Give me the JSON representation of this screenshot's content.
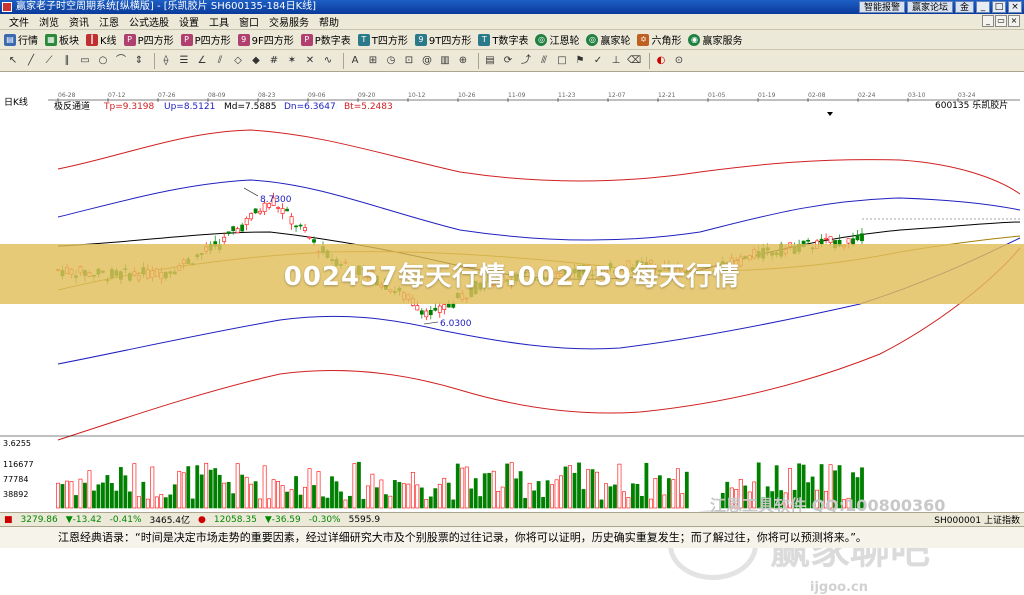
{
  "window": {
    "title": "赢家老子时空周期系统[纵横版] - [乐凯胶片  SH600135-184日K线]",
    "right_buttons": [
      "智能报警",
      "赢家论坛",
      "金"
    ],
    "controls": [
      "_",
      "□",
      "×"
    ]
  },
  "menu": [
    "文件",
    "浏览",
    "资讯",
    "江恩",
    "公式选股",
    "设置",
    "工具",
    "窗口",
    "交易服务",
    "帮助"
  ],
  "toolbar": [
    "行情",
    "板块",
    "K线",
    "P四方形",
    "P四方形",
    "9F四方形",
    "P数字表",
    "T四方形",
    "9T四方形",
    "T数字表",
    "江恩轮",
    "赢家轮",
    "六角形",
    "赢家服务"
  ],
  "chart": {
    "period_label": "日K线",
    "indicator": "极反通道",
    "tp": "Tp=9.3198",
    "up": "Up=8.5121",
    "md": "Md=7.5885",
    "dn": "Dn=6.3647",
    "bt": "Bt=5.2483",
    "stock": "600135 乐凯胶片",
    "dates": [
      "06-28",
      "07-12",
      "07-26",
      "08-09",
      "08-23",
      "09-06",
      "09-20",
      "10-12",
      "10-26",
      "11-09",
      "11-23",
      "12-07",
      "12-21",
      "01-05",
      "01-19",
      "02-08",
      "02-24",
      "03-10",
      "03-24"
    ],
    "high_label": "8.7300",
    "low_label": "6.0300",
    "vol_top": "3.6255",
    "vol_labels": [
      "116677",
      "77784",
      "38892"
    ]
  },
  "chart_data": {
    "type": "bar",
    "title": "",
    "xlabel": "",
    "ylabel": "",
    "categories": [
      "06-28",
      "07-12",
      "07-26",
      "08-09",
      "08-23",
      "09-06",
      "09-20",
      "10-12",
      "10-26",
      "11-09",
      "11-23",
      "12-07",
      "12-21",
      "01-05",
      "01-19",
      "02-08",
      "02-24",
      "03-10",
      "03-24"
    ],
    "series": [
      {
        "values": [
          7.1,
          7.0,
          7.05,
          7.6,
          8.5,
          7.4,
          6.9,
          6.2,
          6.9,
          7.0,
          7.1,
          7.2,
          7.0,
          7.4,
          7.6,
          7.7
        ]
      }
    ],
    "ylim": [
      6.03,
      8.73
    ]
  },
  "watermark": {
    "line1": "江恩工具软件  QQ:100800360",
    "big": "赢家聊吧",
    "small": "ijgoo.cn"
  },
  "banner": "002457每天行情:002759每天行情",
  "status": {
    "sh": "3279.86",
    "sh_chg": "▼-13.42",
    "sh_pct": "-0.41%",
    "sh_amt": "3465.4亿",
    "sz": "12058.35",
    "sz_chg": "▼-36.59",
    "sz_pct": "-0.30%",
    "sz_amt": "5595.9",
    "code": "SH000001 上证指数"
  },
  "tip": "江恩经典语录：“时间是决定市场走势的重要因素，经过详细研究大市及个别股票的过往记录，你将可以证明，历史确实重复发生；而了解过往，你将可以预测将来。”。",
  "colors": {
    "up": "#ff0000",
    "down": "#008000",
    "upper_band": "#d02020",
    "mid_band": "#2020c0",
    "lower_band": "#000000",
    "base": "#a08000"
  }
}
